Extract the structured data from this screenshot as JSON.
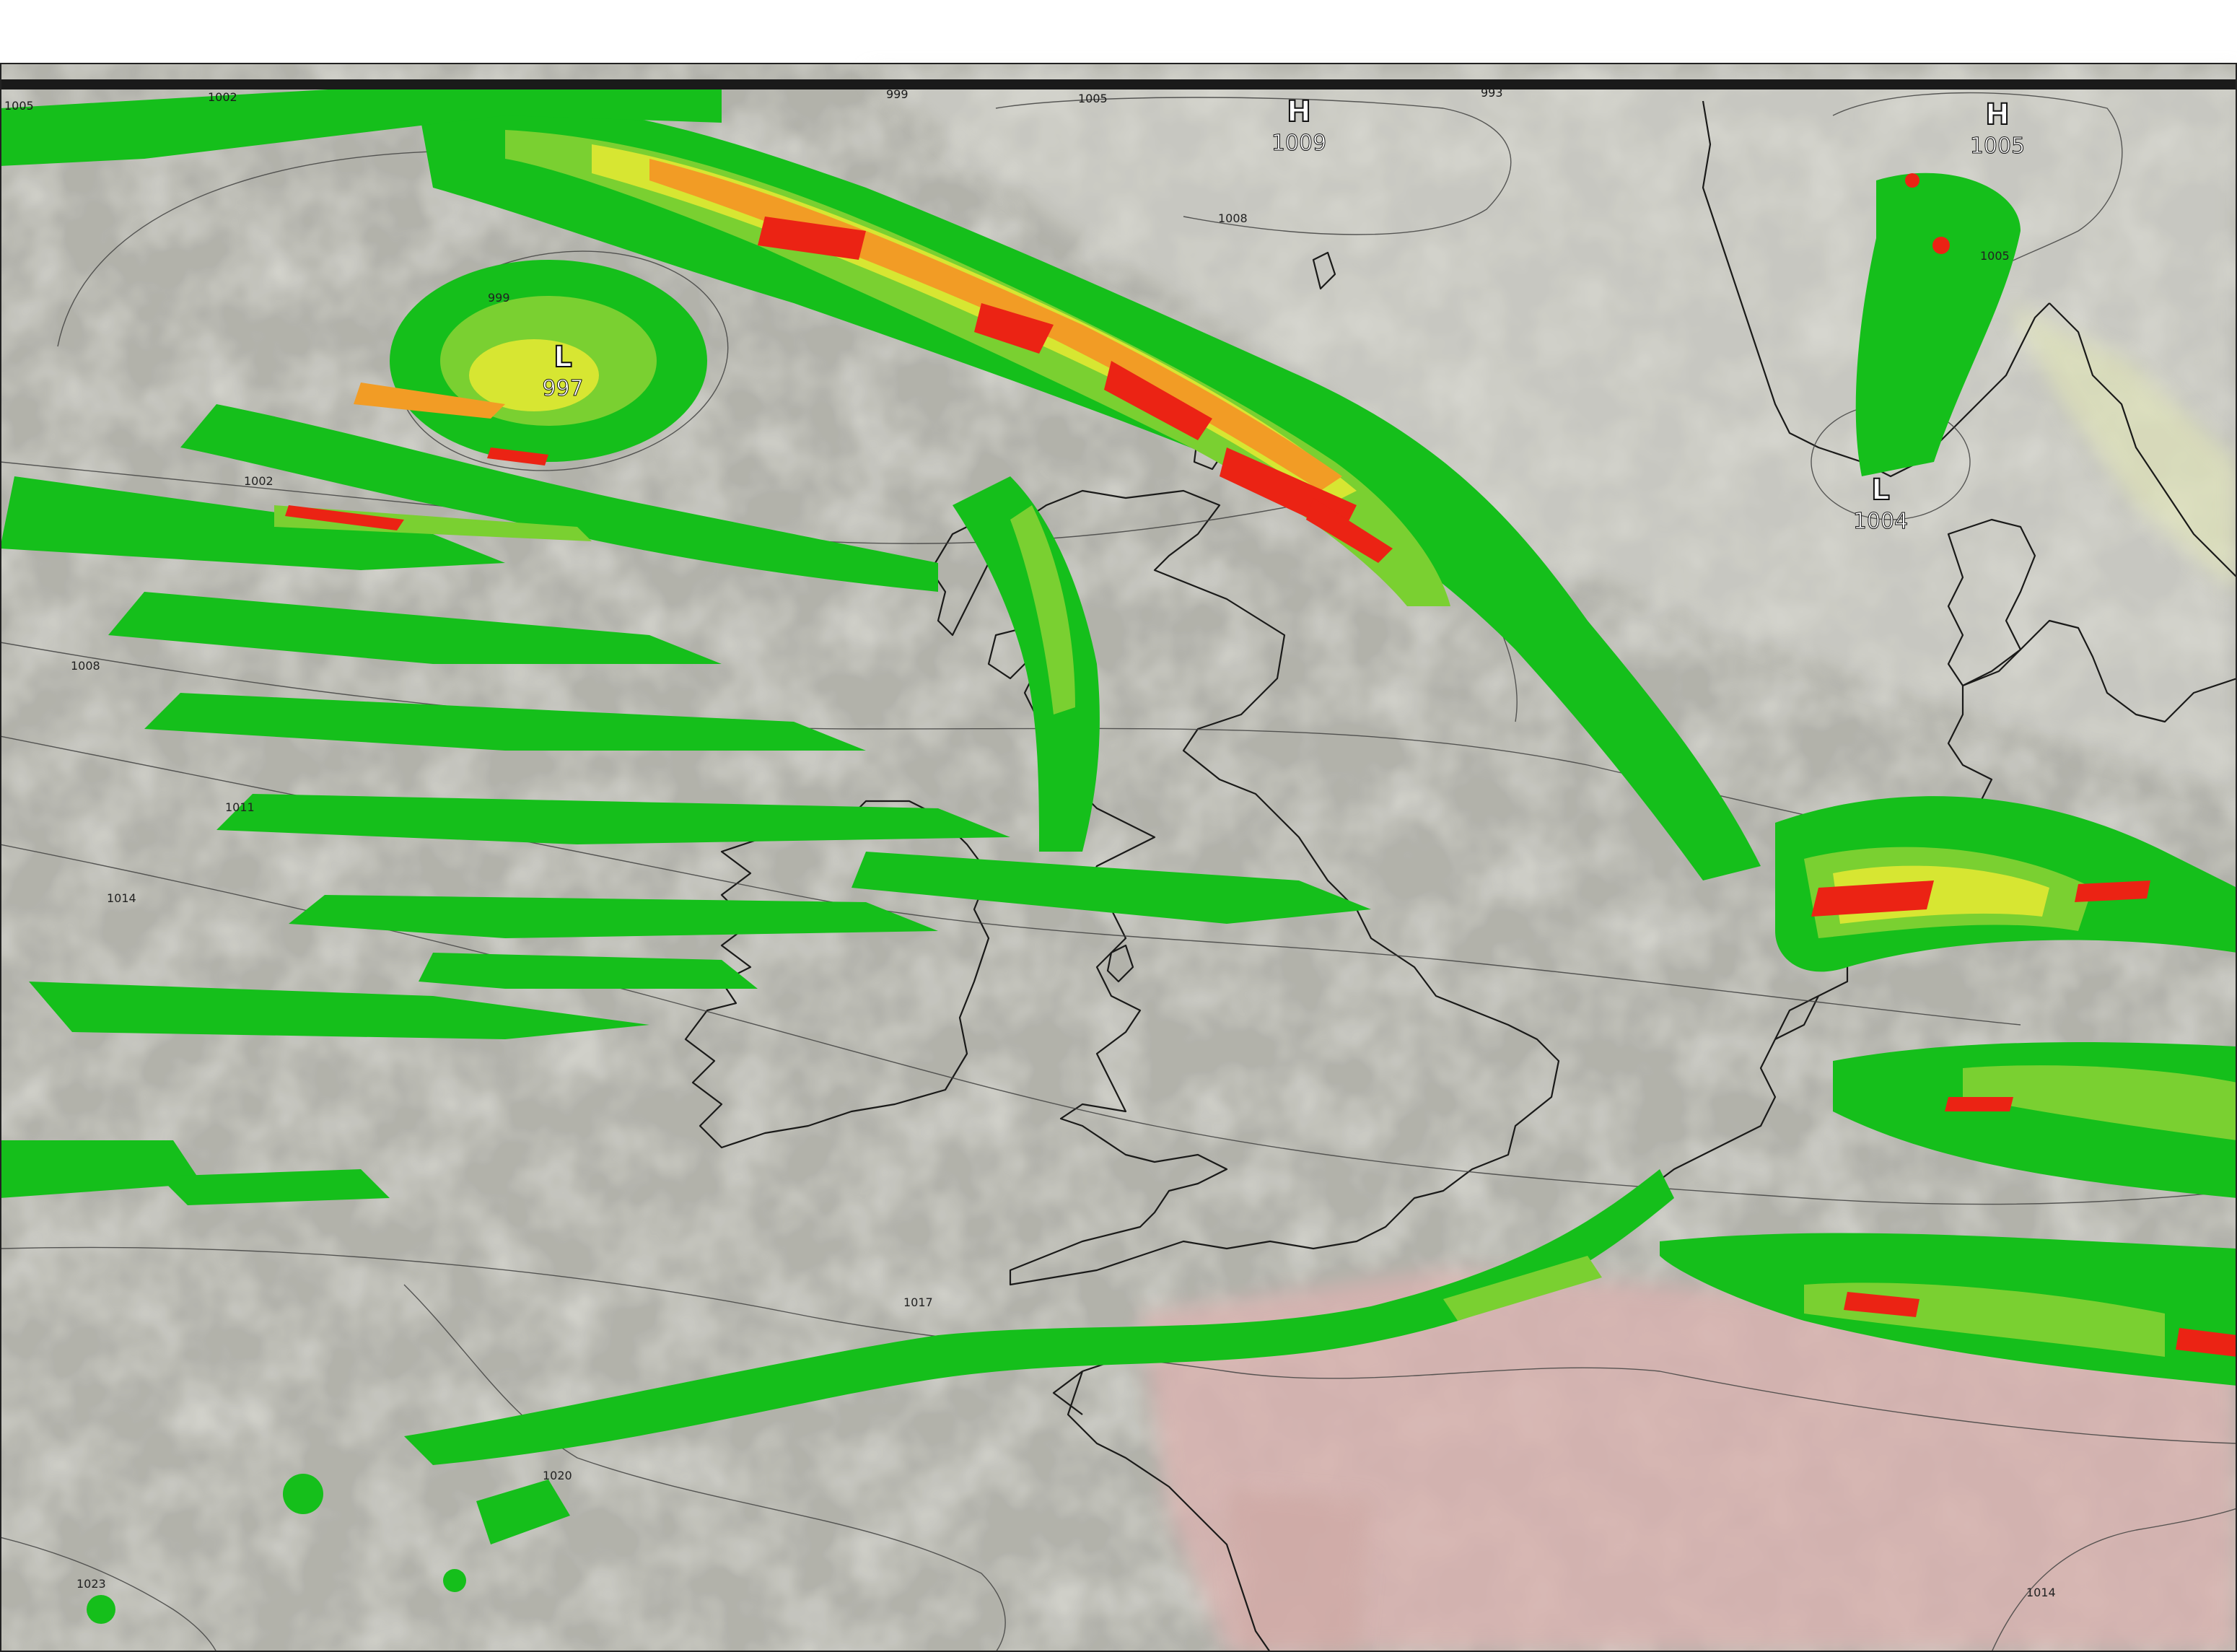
{
  "colors": {
    "land": "#c7c5bb",
    "sea_cloud": "#b3b3ac",
    "precip_light": "#0cbf14",
    "precip_mod": "#76d12b",
    "precip_heavy": "#d8e82c",
    "precip_orange": "#f59a1e",
    "precip_extreme": "#ee1b0c",
    "warm_surface": "#d9b4b2",
    "coastline": "#111111",
    "isobar": "#3a3a3a"
  },
  "pressure_systems": [
    {
      "type": "L",
      "value": "997"
    },
    {
      "type": "H",
      "value": "1009"
    },
    {
      "type": "H",
      "value": "1005"
    },
    {
      "type": "L",
      "value": "1004"
    }
  ],
  "isobar_labels": [
    "999",
    "1002",
    "1005",
    "1005",
    "1008",
    "1008",
    "1011",
    "1014",
    "1017",
    "1020",
    "1023",
    "1014"
  ],
  "top_edge_labels": [
    "1005",
    "1002",
    "999",
    "1005",
    "993"
  ],
  "icons": {
    "low": "low-pressure-marker",
    "high": "high-pressure-marker"
  }
}
